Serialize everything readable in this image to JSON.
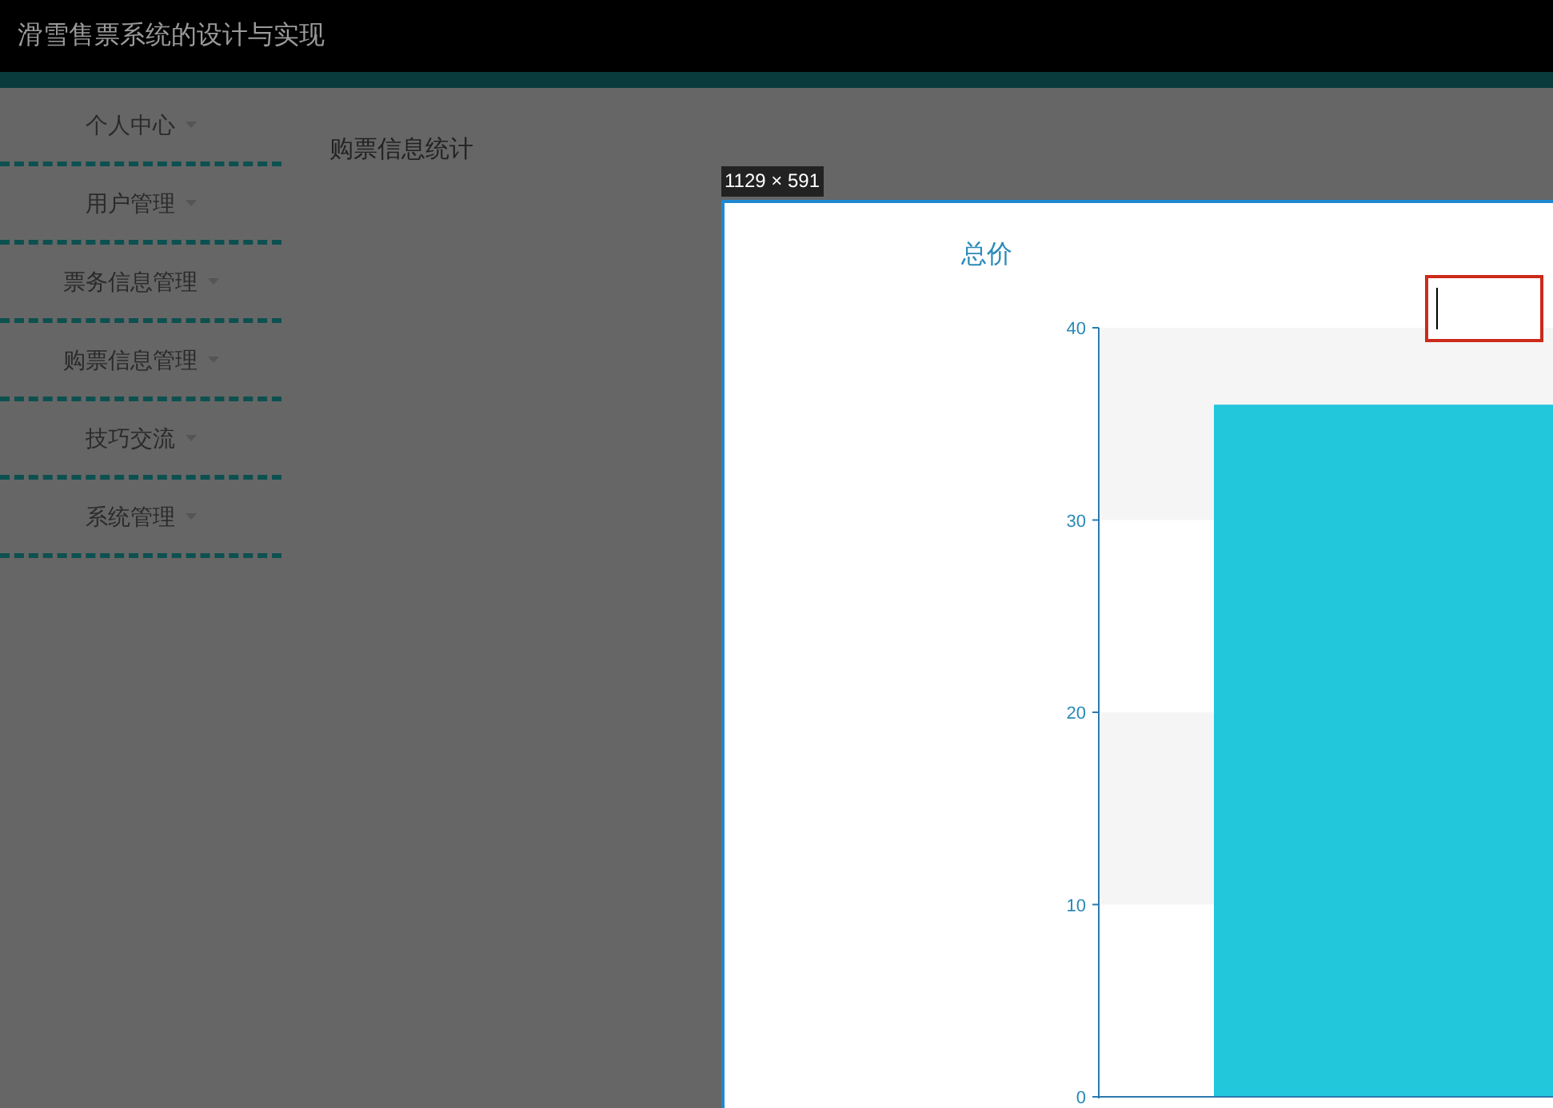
{
  "header": {
    "title": "滑雪售票系统的设计与实现"
  },
  "sidebar": {
    "items": [
      {
        "label": "个人中心"
      },
      {
        "label": "用户管理"
      },
      {
        "label": "票务信息管理"
      },
      {
        "label": "购票信息管理"
      },
      {
        "label": "技巧交流"
      },
      {
        "label": "系统管理"
      }
    ]
  },
  "page_title": "购票信息统计",
  "size_label": "1129 × 591",
  "chart": {
    "chart_data": {
      "type": "bar",
      "title": "总价",
      "values": [
        36
      ],
      "ylim": [
        0,
        40
      ],
      "yticks": [
        0,
        10,
        20,
        30,
        40
      ]
    }
  }
}
